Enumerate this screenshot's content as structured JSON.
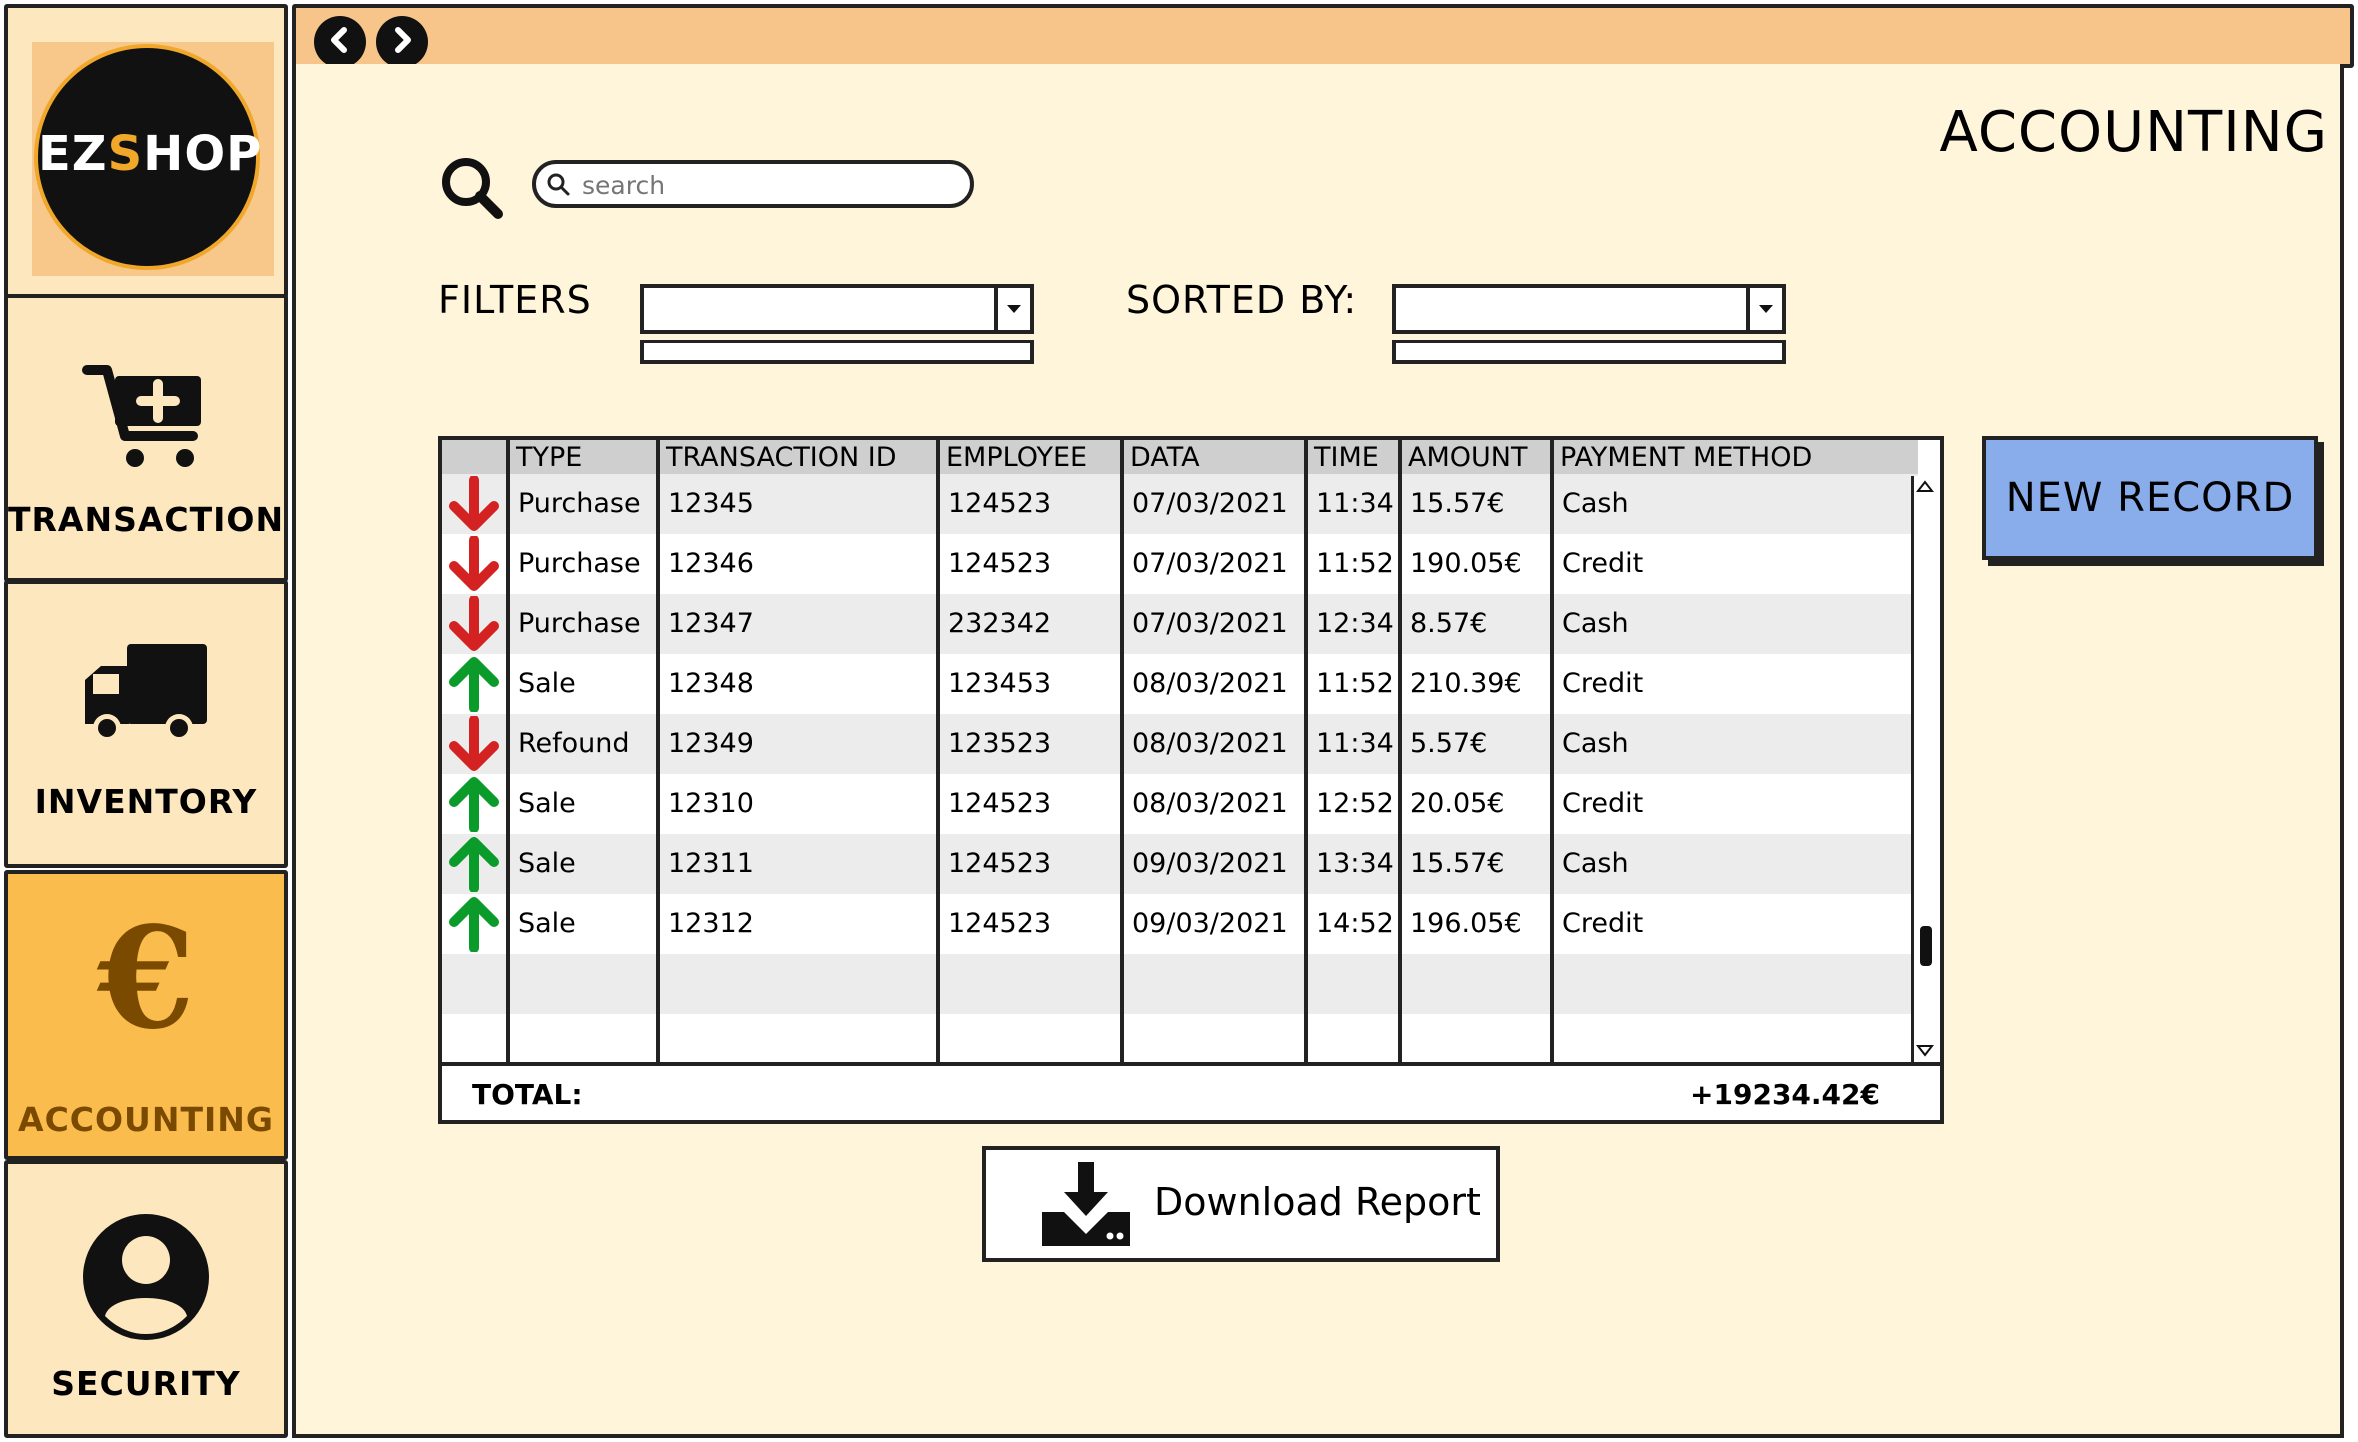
{
  "logo": {
    "text_left": "EZ",
    "text_s": "S",
    "text_right": "HOP"
  },
  "sidebar": {
    "items": [
      {
        "label": "TRANSACTION"
      },
      {
        "label": "INVENTORY"
      },
      {
        "label": "ACCOUNTING"
      },
      {
        "label": "SECURITY"
      }
    ],
    "active": "ACCOUNTING"
  },
  "page": {
    "title": "ACCOUNTING"
  },
  "search": {
    "placeholder": "search"
  },
  "filters": {
    "label": "FILTERS",
    "value": ""
  },
  "sorted_by": {
    "label": "SORTED BY:",
    "value": ""
  },
  "table": {
    "columns": [
      "TYPE",
      "TRANSACTION ID",
      "EMPLOYEE",
      "DATA",
      "TIME",
      "AMOUNT",
      "PAYMENT METHOD"
    ],
    "rows": [
      {
        "direction": "down",
        "type": "Purchase",
        "id": "12345",
        "employee": "124523",
        "date": "07/03/2021",
        "time": "11:34",
        "amount": "15.57€",
        "method": "Cash"
      },
      {
        "direction": "down",
        "type": "Purchase",
        "id": "12346",
        "employee": "124523",
        "date": "07/03/2021",
        "time": "11:52",
        "amount": "190.05€",
        "method": "Credit"
      },
      {
        "direction": "down",
        "type": "Purchase",
        "id": "12347",
        "employee": "232342",
        "date": "07/03/2021",
        "time": "12:34",
        "amount": "8.57€",
        "method": "Cash"
      },
      {
        "direction": "up",
        "type": "Sale",
        "id": "12348",
        "employee": "123453",
        "date": "08/03/2021",
        "time": "11:52",
        "amount": "210.39€",
        "method": "Credit"
      },
      {
        "direction": "down",
        "type": "Refound",
        "id": "12349",
        "employee": "123523",
        "date": "08/03/2021",
        "time": "11:34",
        "amount": "5.57€",
        "method": "Cash"
      },
      {
        "direction": "up",
        "type": "Sale",
        "id": "12310",
        "employee": "124523",
        "date": "08/03/2021",
        "time": "12:52",
        "amount": "20.05€",
        "method": "Credit"
      },
      {
        "direction": "up",
        "type": "Sale",
        "id": "12311",
        "employee": "124523",
        "date": "09/03/2021",
        "time": "13:34",
        "amount": "15.57€",
        "method": "Cash"
      },
      {
        "direction": "up",
        "type": "Sale",
        "id": "12312",
        "employee": "124523",
        "date": "09/03/2021",
        "time": "14:52",
        "amount": "196.05€",
        "method": "Credit"
      }
    ]
  },
  "total": {
    "label": "TOTAL:",
    "value": "+19234.42€"
  },
  "buttons": {
    "new_record": "NEW RECORD",
    "download_report": "Download Report"
  },
  "icons": {
    "back": "chevron-left-icon",
    "forward": "chevron-right-icon",
    "search": "search-icon",
    "transaction": "cart-plus-icon",
    "inventory": "truck-icon",
    "accounting": "euro-icon",
    "security": "user-icon",
    "download": "download-icon",
    "arrow_up": "arrow-up-icon",
    "arrow_down": "arrow-down-icon"
  },
  "colors": {
    "sidebar_bg": "#fde7bf",
    "sidebar_active": "#fbbc4e",
    "titlebar": "#f7c48a",
    "main_bg": "#fff5da",
    "new_record_bg": "#89aceb",
    "arrow_up": "#0a9b2a",
    "arrow_down": "#d42121"
  }
}
